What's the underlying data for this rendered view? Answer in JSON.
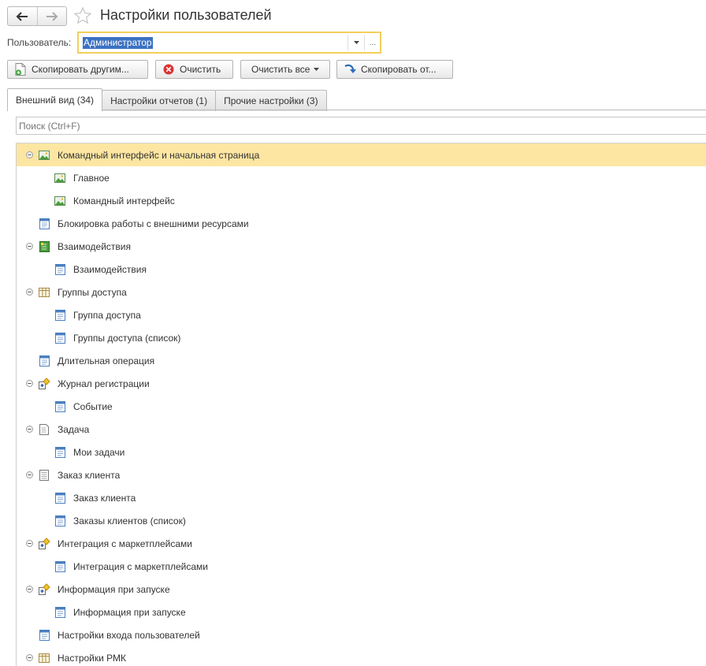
{
  "window": {
    "title": "Настройки пользователей"
  },
  "user": {
    "label": "Пользователь:",
    "value": "Администратор",
    "choose_label": "..."
  },
  "toolbar": {
    "copy_to_others": "Скопировать другим...",
    "clear": "Очистить",
    "clear_all": "Очистить все",
    "copy_from": "Скопировать от..."
  },
  "tabs": [
    {
      "label": "Внешний вид (34)"
    },
    {
      "label": "Настройки отчетов (1)"
    },
    {
      "label": "Прочие настройки (3)"
    }
  ],
  "search": {
    "placeholder": "Поиск (Ctrl+F)"
  },
  "tree": [
    {
      "label": "Командный интерфейс и начальная страница",
      "level": 0,
      "icon": "picture-icon",
      "expanded": true,
      "selected": true
    },
    {
      "label": "Главное",
      "level": 1,
      "icon": "picture-icon"
    },
    {
      "label": "Командный интерфейс",
      "level": 1,
      "icon": "picture-icon"
    },
    {
      "label": "Блокировка работы с внешними ресурсами",
      "level": 0,
      "icon": "form-icon"
    },
    {
      "label": "Взаимодействия",
      "level": 0,
      "icon": "journal-icon",
      "expanded": true
    },
    {
      "label": "Взаимодействия",
      "level": 1,
      "icon": "form-icon"
    },
    {
      "label": "Группы доступа",
      "level": 0,
      "icon": "catalog-icon",
      "expanded": true
    },
    {
      "label": "Группа доступа",
      "level": 1,
      "icon": "form-icon"
    },
    {
      "label": "Группы доступа (список)",
      "level": 1,
      "icon": "form-icon"
    },
    {
      "label": "Длительная операция",
      "level": 0,
      "icon": "form-icon"
    },
    {
      "label": "Журнал регистрации",
      "level": 0,
      "icon": "processing-icon",
      "expanded": true
    },
    {
      "label": "Событие",
      "level": 1,
      "icon": "form-icon"
    },
    {
      "label": "Задача",
      "level": 0,
      "icon": "document-icon",
      "expanded": true
    },
    {
      "label": "Мои задачи",
      "level": 1,
      "icon": "form-icon"
    },
    {
      "label": "Заказ клиента",
      "level": 0,
      "icon": "document-lines-icon",
      "expanded": true
    },
    {
      "label": "Заказ клиента",
      "level": 1,
      "icon": "form-icon"
    },
    {
      "label": "Заказы клиентов (список)",
      "level": 1,
      "icon": "form-icon"
    },
    {
      "label": "Интеграция с маркетплейсами",
      "level": 0,
      "icon": "processing-icon",
      "expanded": true
    },
    {
      "label": "Интеграция с маркетплейсами",
      "level": 1,
      "icon": "form-icon"
    },
    {
      "label": "Информация при запуске",
      "level": 0,
      "icon": "processing-icon",
      "expanded": true
    },
    {
      "label": "Информация при запуске",
      "level": 1,
      "icon": "form-icon"
    },
    {
      "label": "Настройки входа пользователей",
      "level": 0,
      "icon": "form-icon"
    },
    {
      "label": "Настройки РМК",
      "level": 0,
      "icon": "catalog-icon",
      "expanded": true
    }
  ]
}
